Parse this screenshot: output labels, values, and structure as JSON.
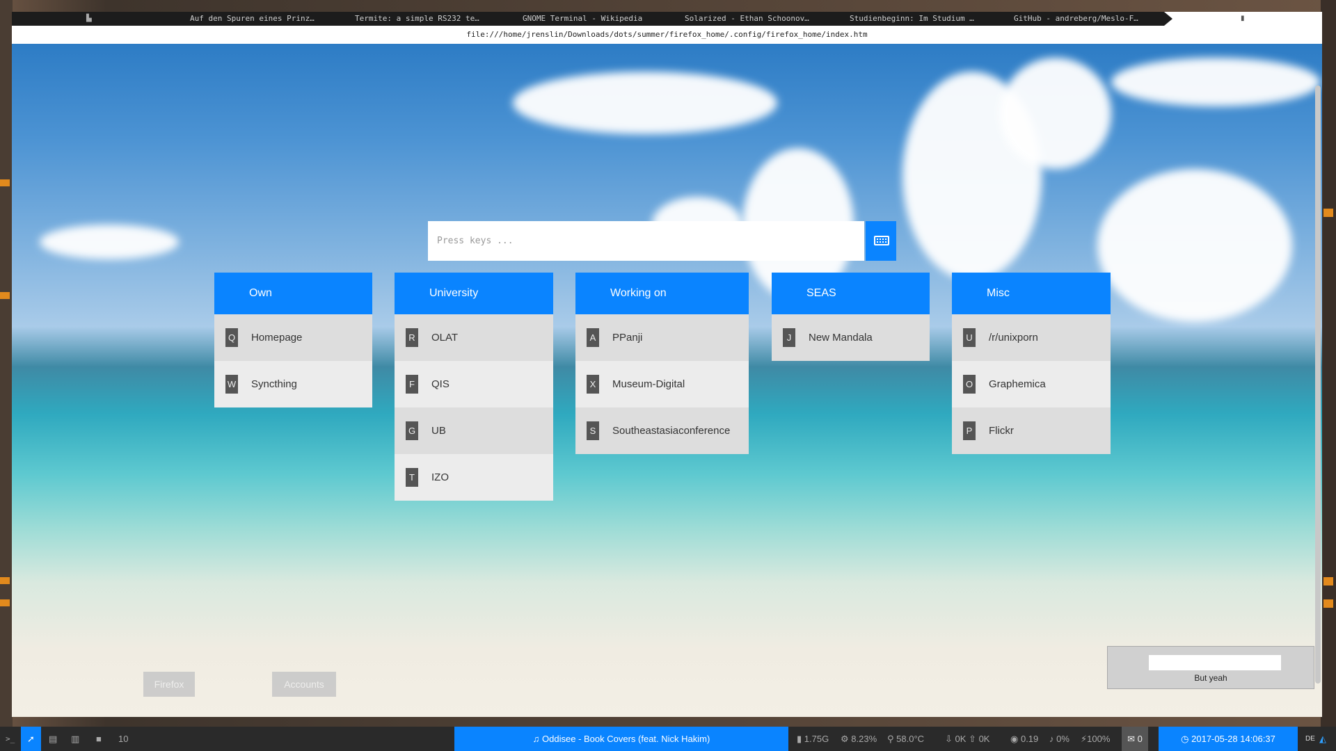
{
  "tabs": [
    {
      "label": "Auf den Spuren eines Prinz…"
    },
    {
      "label": "Termite: a simple RS232 te…"
    },
    {
      "label": "GNOME Terminal - Wikipedia"
    },
    {
      "label": "Solarized - Ethan Schoonov…"
    },
    {
      "label": "Studienbeginn: Im Studium …"
    },
    {
      "label": "GitHub - andreberg/Meslo-F…"
    }
  ],
  "url": "file:///home/jrenslin/Downloads/dots/summer/firefox_home/.config/firefox_home/index.htm",
  "search": {
    "placeholder": "Press keys ..."
  },
  "groups": [
    {
      "title": "Own",
      "links": [
        {
          "key": "Q",
          "label": "Homepage"
        },
        {
          "key": "W",
          "label": "Syncthing"
        }
      ]
    },
    {
      "title": "University",
      "links": [
        {
          "key": "R",
          "label": "OLAT"
        },
        {
          "key": "F",
          "label": "QIS"
        },
        {
          "key": "G",
          "label": "UB"
        },
        {
          "key": "T",
          "label": "IZO"
        }
      ]
    },
    {
      "title": "Working on",
      "links": [
        {
          "key": "A",
          "label": "PPanji"
        },
        {
          "key": "X",
          "label": "Museum-Digital"
        },
        {
          "key": "S",
          "label": "Southeastasiaconference"
        }
      ]
    },
    {
      "title": "SEAS",
      "links": [
        {
          "key": "J",
          "label": "New Mandala"
        }
      ]
    },
    {
      "title": "Misc",
      "links": [
        {
          "key": "U",
          "label": "/r/unixporn"
        },
        {
          "key": "O",
          "label": "Graphemica"
        },
        {
          "key": "P",
          "label": "Flickr"
        }
      ]
    }
  ],
  "footer_buttons": {
    "firefox": "Firefox",
    "accounts": "Accounts"
  },
  "note": {
    "text": "But yeah"
  },
  "statusbar": {
    "prompt": ">_",
    "workspace_count": "10",
    "now_playing": "Oddisee - Book Covers (feat. Nick Hakim)",
    "memory": "1.75G",
    "cpu": "8.23%",
    "temp": "58.0°C",
    "net_down": "0K",
    "net_up": "0K",
    "load": "0.19",
    "volume": "0%",
    "battery": "100%",
    "mail": "0",
    "datetime": "2017-05-28 14:06:37",
    "layout": "DE"
  },
  "colors": {
    "accent": "#0a84ff",
    "link_bg": "#ececec",
    "link_bg_alt": "#dddddd",
    "key_bg": "#555555"
  }
}
